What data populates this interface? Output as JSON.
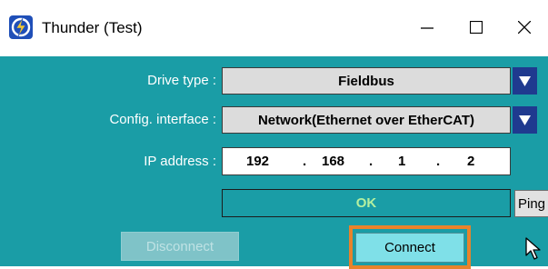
{
  "window": {
    "title": "Thunder (Test)",
    "icon": "thunder-logo-icon",
    "controls": [
      "minimize-icon",
      "maximize-icon",
      "close-icon"
    ]
  },
  "form": {
    "drive_type": {
      "label": "Drive type :",
      "value": "Fieldbus"
    },
    "config_interface": {
      "label": "Config. interface :",
      "value": "Network(Ethernet over EtherCAT)"
    },
    "ip_address": {
      "label": "IP address :",
      "octets": [
        "192",
        "168",
        "1",
        "2"
      ],
      "separator": "."
    },
    "status": {
      "text": "OK"
    }
  },
  "buttons": {
    "ping": "Ping",
    "disconnect": "Disconnect",
    "connect": "Connect"
  },
  "colors": {
    "background": "#1a9da6",
    "dropdown": "#1f3a8f",
    "status_text": "#b4f0a0",
    "highlight": "#e8832b"
  }
}
